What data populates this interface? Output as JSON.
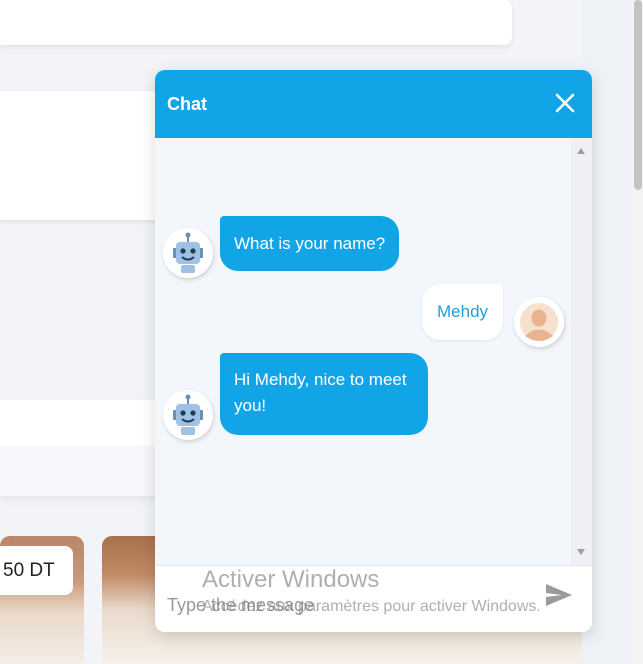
{
  "background": {
    "price_badge": "50 DT"
  },
  "chat": {
    "title": "Chat",
    "accent_color": "#11a5e8",
    "close_icon": "close-icon",
    "messages": [
      {
        "sender": "bot",
        "text": "What is your name?",
        "avatar_icon": "robot-icon"
      },
      {
        "sender": "user",
        "text": "Mehdy",
        "avatar_icon": "user-avatar-icon"
      },
      {
        "sender": "bot",
        "text": "Hi Mehdy, nice to meet you!",
        "avatar_icon": "robot-icon"
      }
    ],
    "input": {
      "value": "",
      "placeholder": "Type the message"
    },
    "send_icon": "send-icon"
  },
  "watermark": {
    "title": "Activer Windows",
    "subtitle": "Accédez aux paramètres pour activer Windows."
  }
}
